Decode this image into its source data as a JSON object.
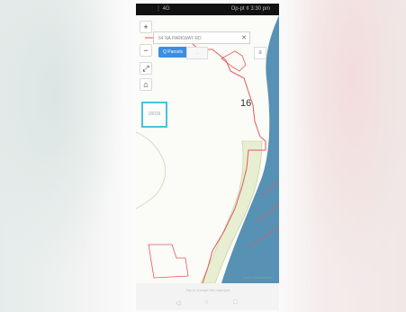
{
  "status_bar": {
    "left": "⋮ 4G",
    "right": "Op-pt ¢ 3:30 pm"
  },
  "map": {
    "search": {
      "value": "64 NA PARKWAY RD",
      "clear_icon": "close-icon"
    },
    "controls": {
      "zoom_in": "+",
      "zoom_out": "−",
      "fullscreen": "⤢",
      "home": "⌂",
      "layers": "≡",
      "locate": "⌖"
    },
    "toolbar": {
      "active": "Q Parcels",
      "inactive": "..."
    },
    "highlight_label": "16016",
    "parcel_number": "16",
    "attribution": "Esri | Geoservices..."
  },
  "bottom": {
    "hint": "Tap to change the map type",
    "nav_back": "◁",
    "nav_home": "○",
    "nav_recent": "□"
  },
  "colors": {
    "boundary": "#e05a5a",
    "water": "#2f6f9a",
    "land": "#fbfbf7",
    "highlight": "#46c2dc",
    "accent": "#3c8ee0"
  }
}
